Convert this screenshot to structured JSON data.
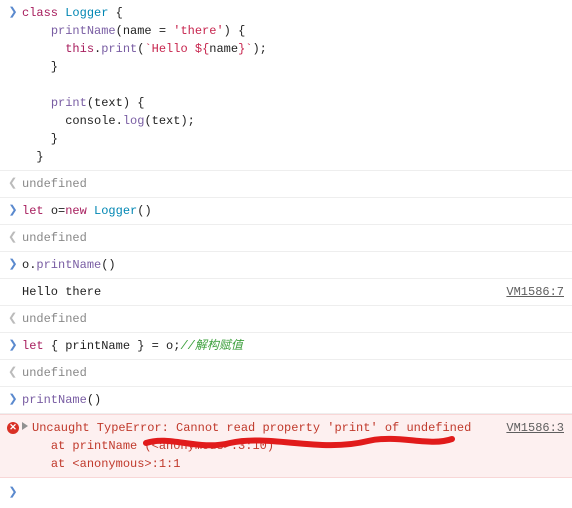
{
  "entries": [
    {
      "kind": "input",
      "tokens": [
        [
          "kw",
          "class "
        ],
        [
          "cls",
          "Logger"
        ],
        [
          "def",
          " {\n"
        ],
        [
          "def",
          "    "
        ],
        [
          "fn",
          "printName"
        ],
        [
          "def",
          "("
        ],
        [
          "def",
          "name"
        ],
        [
          "def",
          " = "
        ],
        [
          "str",
          "'there'"
        ],
        [
          "def",
          ") {\n"
        ],
        [
          "def",
          "      "
        ],
        [
          "this",
          "this"
        ],
        [
          "def",
          "."
        ],
        [
          "fn",
          "print"
        ],
        [
          "def",
          "("
        ],
        [
          "tpl",
          "`Hello ${"
        ],
        [
          "def",
          "name"
        ],
        [
          "tpl",
          "}`"
        ],
        [
          "def",
          ");\n"
        ],
        [
          "def",
          "    }\n\n"
        ],
        [
          "def",
          "    "
        ],
        [
          "fn",
          "print"
        ],
        [
          "def",
          "("
        ],
        [
          "def",
          "text"
        ],
        [
          "def",
          ") {\n"
        ],
        [
          "def",
          "      console."
        ],
        [
          "fn",
          "log"
        ],
        [
          "def",
          "(text);\n"
        ],
        [
          "def",
          "    }\n"
        ],
        [
          "def",
          "  }"
        ]
      ]
    },
    {
      "kind": "result",
      "text": "undefined"
    },
    {
      "kind": "input",
      "tokens": [
        [
          "kw",
          "let "
        ],
        [
          "def",
          "o"
        ],
        [
          "def",
          "="
        ],
        [
          "kw",
          "new "
        ],
        [
          "cls",
          "Logger"
        ],
        [
          "def",
          "()"
        ]
      ]
    },
    {
      "kind": "result",
      "text": "undefined"
    },
    {
      "kind": "input",
      "tokens": [
        [
          "def",
          "o."
        ],
        [
          "fn",
          "printName"
        ],
        [
          "def",
          "()"
        ]
      ]
    },
    {
      "kind": "log",
      "text": "Hello there",
      "source": "VM1586:7"
    },
    {
      "kind": "result",
      "text": "undefined"
    },
    {
      "kind": "input",
      "tokens": [
        [
          "kw",
          "let "
        ],
        [
          "def",
          "{ "
        ],
        [
          "def",
          "printName"
        ],
        [
          "def",
          " } = o;"
        ],
        [
          "com",
          "//解构赋值"
        ]
      ]
    },
    {
      "kind": "result",
      "text": "undefined"
    },
    {
      "kind": "input",
      "tokens": [
        [
          "fn",
          "printName"
        ],
        [
          "def",
          "()"
        ]
      ]
    },
    {
      "kind": "error",
      "source": "VM1586:3",
      "message": "Uncaught TypeError: Cannot read property 'print' of undefined",
      "stack": "    at printName (<anonymous>:3:10)\n    at <anonymous>:1:1"
    }
  ],
  "glyphs": {
    "input": "❯",
    "result": "❮",
    "error_x": "✕"
  }
}
